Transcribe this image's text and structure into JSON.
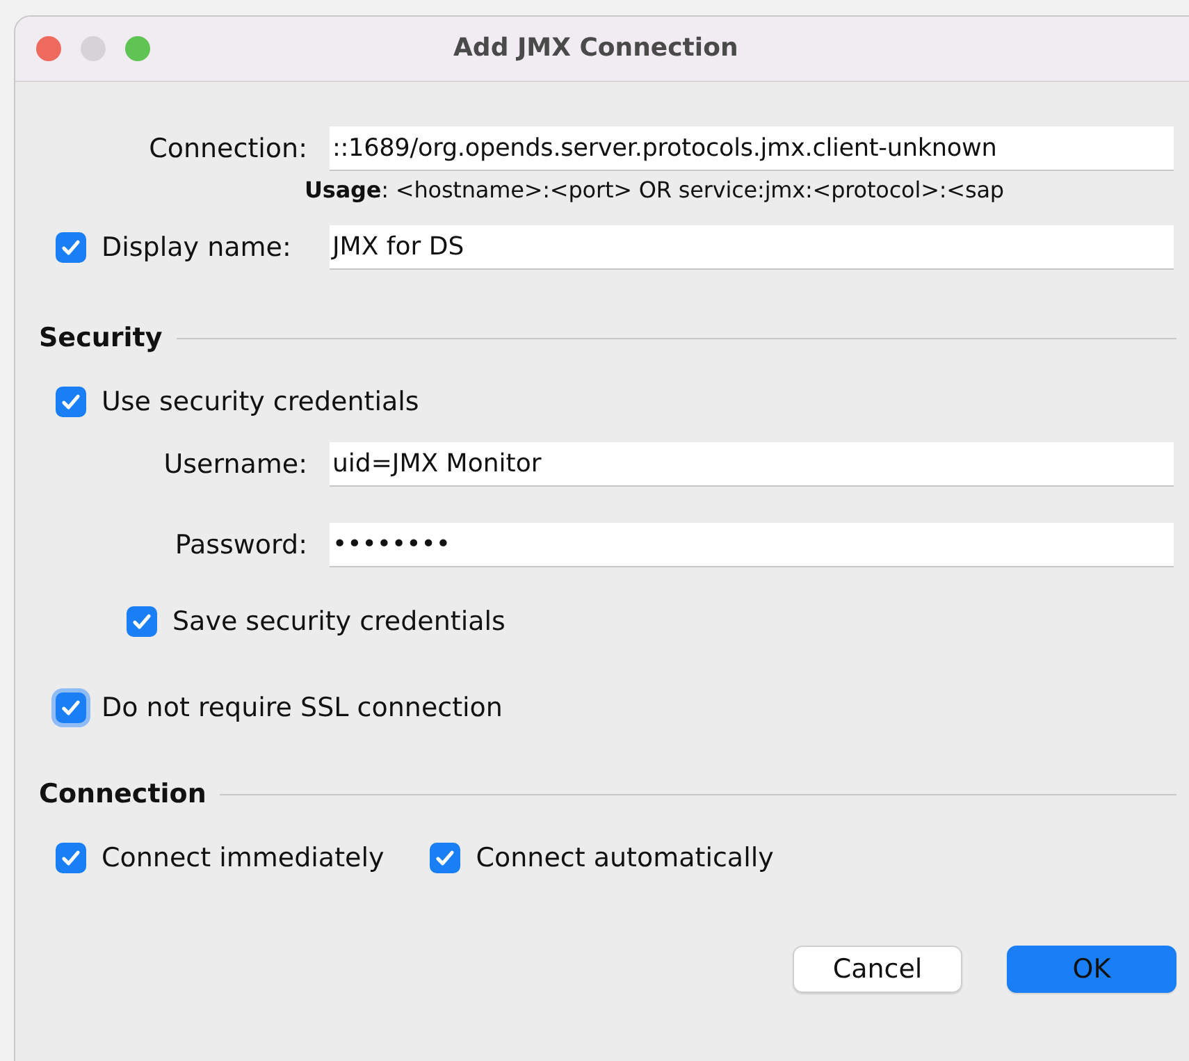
{
  "window": {
    "title": "Add JMX Connection"
  },
  "connection": {
    "label": "Connection:",
    "value": "::1689/org.opends.server.protocols.jmx.client-unknown",
    "usage": "**Usage**: <hostname>:<port> OR service:jmx:<protocol>:<sap"
  },
  "display_name": {
    "label": "Display name:",
    "checked": true,
    "value": "JMX for DS"
  },
  "security": {
    "title": "Security",
    "use_credentials": {
      "label": "Use security credentials",
      "checked": true
    },
    "username": {
      "label": "Username:",
      "value": "uid=JMX Monitor"
    },
    "password": {
      "label": "Password:",
      "value": "••••••••"
    },
    "save_credentials": {
      "label": "Save security credentials",
      "checked": true
    }
  },
  "ssl": {
    "label": "Do not require SSL connection",
    "checked": true,
    "focused": true
  },
  "connection_section": {
    "title": "Connection",
    "options": [
      {
        "label": "Connect immediately",
        "checked": true
      },
      {
        "label": "Connect automatically",
        "checked": true
      }
    ]
  },
  "buttons": [
    {
      "label": "Cancel",
      "default": false
    },
    {
      "label": "OK",
      "default": true
    }
  ]
}
